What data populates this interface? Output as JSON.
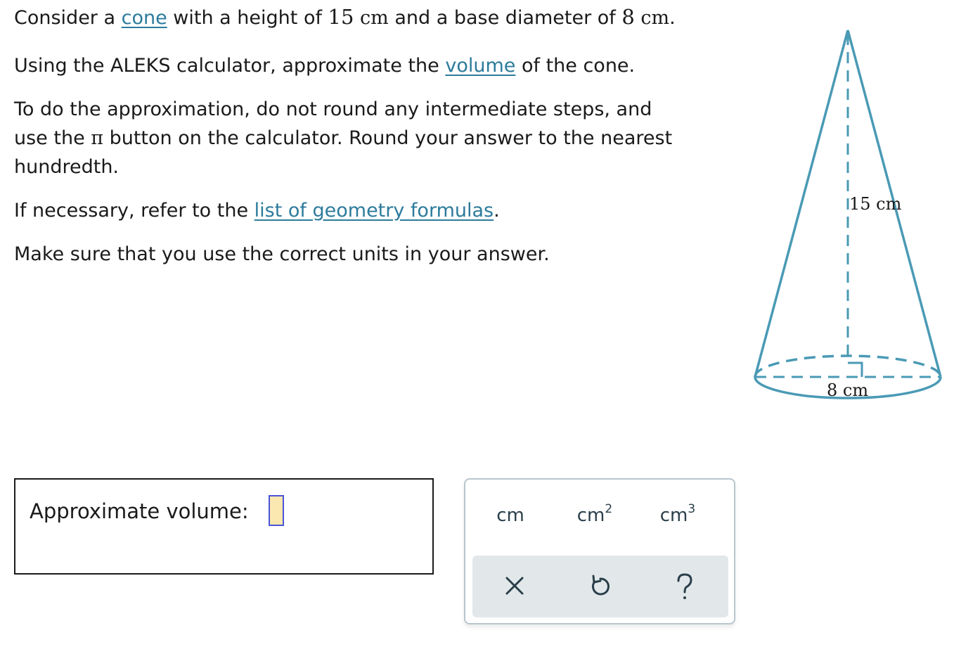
{
  "problem": {
    "intro": {
      "before_cone": "Consider a ",
      "cone_link": "cone",
      "after_cone": " with a height of ",
      "height_value": "15",
      "height_unit": " cm",
      "middle": " and a base diameter of ",
      "diameter_value": "8",
      "diameter_unit": " cm",
      "end": "."
    },
    "instruction1": {
      "before": "Using the ALEKS calculator, approximate the ",
      "volume_link": "volume",
      "after": " of the cone."
    },
    "instruction2": {
      "line1": "To do the approximation, do not round any intermediate steps, and",
      "line2_before": "use the ",
      "pi_symbol": "π",
      "line2_after": " button on the calculator. Round your answer to the nearest",
      "line3": "hundredth."
    },
    "instruction3": {
      "before": "If necessary, refer to the ",
      "formulas_link": "list of geometry formulas",
      "after": "."
    },
    "instruction4": "Make sure that you use the correct units in your answer."
  },
  "answer": {
    "label": "Approximate volume:",
    "value": ""
  },
  "unit_palette": {
    "units": [
      {
        "base": "cm",
        "exponent": ""
      },
      {
        "base": "cm",
        "exponent": "2"
      },
      {
        "base": "cm",
        "exponent": "3"
      }
    ],
    "actions": {
      "clear_icon": "close-icon",
      "undo_icon": "undo-icon",
      "help_icon": "help-icon",
      "clear_symbol": "×",
      "help_symbol": "?"
    }
  },
  "diagram": {
    "height_label": "15 cm",
    "diameter_label": "8 cm",
    "stroke_color": "#4a9ab5"
  }
}
